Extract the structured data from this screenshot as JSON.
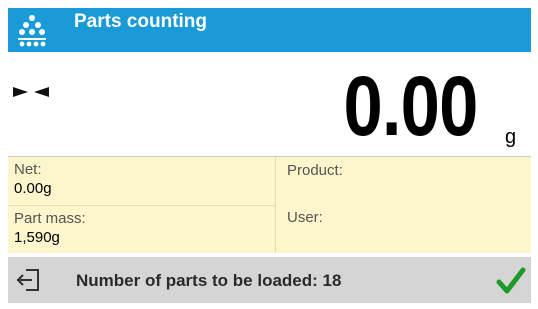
{
  "header": {
    "title": "Parts counting",
    "icon": "parts-pile-icon"
  },
  "weight": {
    "value": "0.00",
    "unit": "g",
    "stable_icon": "stable-indicator-icon"
  },
  "info": {
    "net": {
      "label": "Net:",
      "value": "0.00g"
    },
    "part_mass": {
      "label": "Part mass:",
      "value": "1,590g"
    },
    "product": {
      "label": "Product:",
      "value": ""
    },
    "user": {
      "label": "User:",
      "value": ""
    }
  },
  "footer": {
    "message": "Number of parts to be loaded: 18",
    "exit_icon": "exit-icon",
    "confirm_icon": "checkmark-icon"
  },
  "colors": {
    "header_bg": "#1a9ad6",
    "info_bg": "#fdf6cd",
    "footer_bg": "#d5d5d5",
    "confirm_green": "#1b9a2a"
  }
}
